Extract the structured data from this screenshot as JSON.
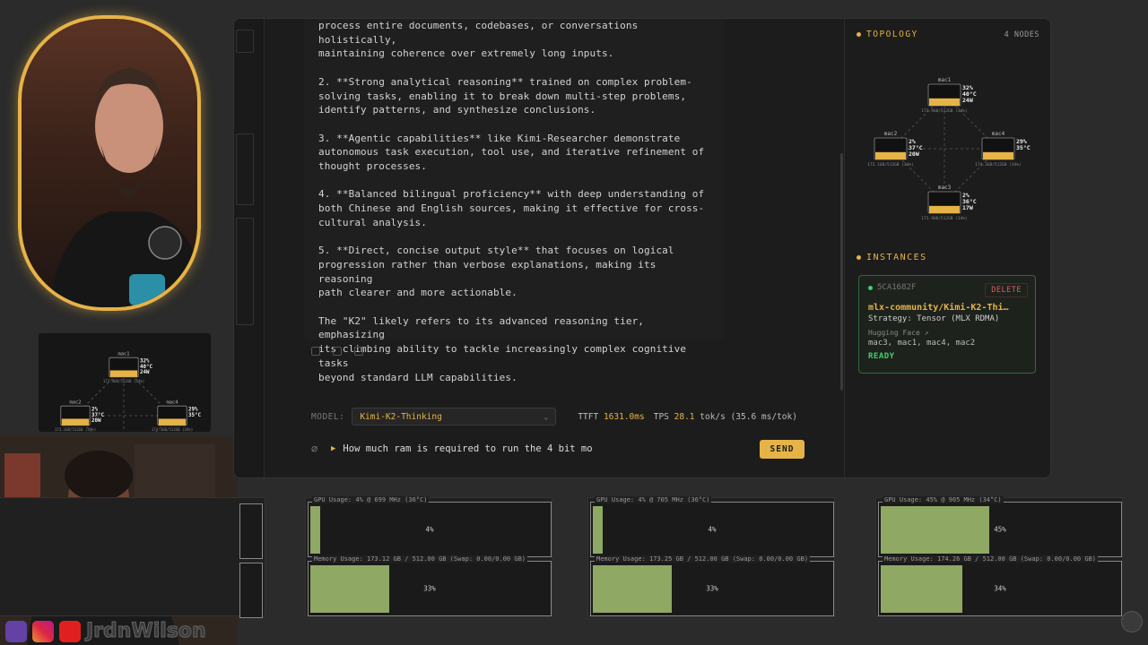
{
  "chat": {
    "paragraphs": [
      "process entire documents, codebases, or conversations holistically,\nmaintaining coherence over extremely long inputs.",
      "2. **Strong analytical reasoning** trained on complex problem-\nsolving tasks, enabling it to break down multi-step problems,\nidentify patterns, and synthesize conclusions.",
      "3. **Agentic capabilities** like Kimi-Researcher demonstrate\nautonomous task execution, tool use, and iterative refinement of\nthought processes.",
      "4. **Balanced bilingual proficiency** with deep understanding of\nboth Chinese and English sources, making it effective for cross-\ncultural analysis.",
      "5. **Direct, concise output style** that focuses on logical\nprogression rather than verbose explanations, making its reasoning\npath clearer and more actionable.",
      "The \"K2\" likely refers to its advanced reasoning tier, emphasizing\nits climbing ability to tackle increasingly complex cognitive tasks\nbeyond standard LLM capabilities."
    ],
    "model_label": "MODEL:",
    "model_value": "Kimi-K2-Thinking",
    "ttft_label": "TTFT",
    "ttft_value": "1631.0ms",
    "tps_label": "TPS",
    "tps_value": "28.1",
    "tps_unit": "tok/s (35.6 ms/tok)",
    "input_value": "How much ram is required to run the 4 bit mo",
    "send_label": "SEND"
  },
  "topology": {
    "title": "TOPOLOGY",
    "count": "4 NODES",
    "nodes": [
      {
        "name": "mac1",
        "gpu": "32%",
        "temp": "40°C",
        "power": "24W",
        "mem": "173.9GB/512GB (34%)",
        "fill": 0.34
      },
      {
        "name": "mac2",
        "gpu": "2%",
        "temp": "37°C",
        "power": "20W",
        "mem": "173.1GB/512GB (34%)",
        "fill": 0.34
      },
      {
        "name": "mac4",
        "gpu": "29%",
        "temp": "35°C",
        "power": "",
        "mem": "174.3GB/512GB (34%)",
        "fill": 0.34
      },
      {
        "name": "mac3",
        "gpu": "2%",
        "temp": "36°C",
        "power": "17W",
        "mem": "173.9GB/512GB (34%)",
        "fill": 0.34
      }
    ]
  },
  "instances": {
    "title": "INSTANCES",
    "id": "5CA1682F",
    "delete_label": "DELETE",
    "name": "mlx-community/Kimi-K2-Thi…",
    "strategy": "Strategy: Tensor (MLX RDMA)",
    "hf_label": "Hugging Face ↗",
    "nodes": "mac3, mac1, mac4, mac2",
    "status": "READY"
  },
  "monitors": [
    {
      "gpu_title": "GPU Usage: 4% @ 699 MHz (36°C)",
      "gpu_pct": "4%",
      "gpu_fill": 0.04,
      "mem_title": "Memory Usage: 173.12 GB / 512.00 GB (Swap: 0.00/0.00 GB)",
      "mem_pct": "33%",
      "mem_fill": 0.33
    },
    {
      "gpu_title": "GPU Usage: 4% @ 705 MHz (36°C)",
      "gpu_pct": "4%",
      "gpu_fill": 0.04,
      "mem_title": "Memory Usage: 173.25 GB / 512.00 GB (Swap: 0.00/0.00 GB)",
      "mem_pct": "33%",
      "mem_fill": 0.33
    },
    {
      "gpu_title": "GPU Usage: 45% @ 905 MHz (34°C)",
      "gpu_pct": "45%",
      "gpu_fill": 0.45,
      "mem_title": "Memory Usage: 174.26 GB / 512.00 GB (Swap: 0.00/0.00 GB)",
      "mem_pct": "34%",
      "mem_fill": 0.34
    }
  ],
  "overlay": {
    "channel_name": "JrdnWilson"
  },
  "colors": {
    "accent": "#e6b347",
    "ready": "#3fd06a",
    "delete": "#e05a5a",
    "bar_fill": "#8fa864"
  }
}
